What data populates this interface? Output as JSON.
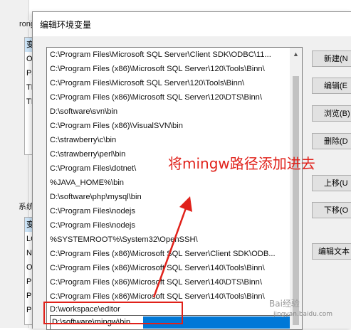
{
  "background_window": {
    "group1_label": "rong",
    "group1_items": [
      "变",
      "O",
      "Pa",
      "TE",
      "TI"
    ],
    "group2_label": "系统",
    "group2_items": [
      "变",
      "LC",
      "N",
      "O",
      "P",
      "Pa",
      "PF",
      "PF"
    ]
  },
  "dialog": {
    "title": "编辑环境变量",
    "paths": [
      "C:\\Program Files\\Microsoft SQL Server\\Client SDK\\ODBC\\11...",
      "C:\\Program Files (x86)\\Microsoft SQL Server\\120\\Tools\\Binn\\",
      "C:\\Program Files\\Microsoft SQL Server\\120\\Tools\\Binn\\",
      "C:\\Program Files (x86)\\Microsoft SQL Server\\120\\DTS\\Binn\\",
      "D:\\software\\svn\\bin",
      "C:\\Program Files (x86)\\VisualSVN\\bin",
      "C:\\strawberry\\c\\bin",
      "C:\\strawberry\\perl\\bin",
      "C:\\Program Files\\dotnet\\",
      "%JAVA_HOME%\\bin",
      "D:\\software\\php\\mysql\\bin",
      "C:\\Program Files\\nodejs",
      "C:\\Program Files\\nodejs",
      "%SYSTEMROOT%\\System32\\OpenSSH\\",
      "C:\\Program Files (x86)\\Microsoft SQL Server\\Client SDK\\ODB...",
      "C:\\Program Files (x86)\\Microsoft SQL Server\\140\\Tools\\Binn\\",
      "C:\\Program Files (x86)\\Microsoft SQL Server\\140\\DTS\\Binn\\",
      "C:\\Program Files (x86)\\Microsoft SQL Server\\140\\Tools\\Binn\\",
      "D:\\workspace\\editor"
    ],
    "editing_value": "D:\\software\\mingw\\bin",
    "buttons": {
      "new": "新建(N",
      "edit": "编辑(E",
      "browse": "浏览(B)",
      "delete": "删除(D",
      "move_up": "上移(U",
      "move_down": "下移(O",
      "edit_text": "编辑文本"
    }
  },
  "annotation": {
    "text": "将mingw路径添加进去",
    "color": "#e0211a"
  },
  "watermark": {
    "main": "Bai经验",
    "sub": "jingyan.baidu.com"
  },
  "colors": {
    "selection": "#0078d7",
    "annotation": "#e0211a"
  }
}
